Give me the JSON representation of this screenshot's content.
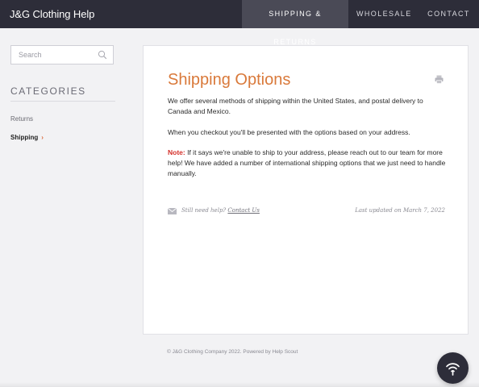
{
  "header": {
    "brand": "J&G Clothing Help",
    "nav": [
      {
        "label": "SHIPPING & RETURNS",
        "active": true
      },
      {
        "label": "WHOLESALE",
        "active": false
      },
      {
        "label": "CONTACT",
        "active": false
      }
    ]
  },
  "sidebar": {
    "search_placeholder": "Search",
    "categories_title": "CATEGORIES",
    "items": [
      {
        "label": "Returns",
        "active": false
      },
      {
        "label": "Shipping",
        "active": true
      }
    ]
  },
  "article": {
    "title": "Shipping Options",
    "paragraph1": "We offer several methods of shipping within the United States, and postal delivery to Canada and Mexico.",
    "paragraph2": "When you checkout you'll be presented with the options based on your address.",
    "note_label": "Note:",
    "note_text": " If it says we're unable to ship to your address, please reach out to our team for more help! We have added a number of international shipping options that we just need to handle manually.",
    "help_prefix": "Still need help? ",
    "contact_link": "Contact Us",
    "last_updated": "Last updated on March 7, 2022"
  },
  "footer": {
    "text": "© J&G Clothing Company 2022. Powered by Help Scout"
  },
  "colors": {
    "accent": "#d9793a",
    "note": "#d4302a",
    "header_bg": "#2d2d39"
  },
  "icons": [
    "search-icon",
    "print-icon",
    "mail-icon",
    "beacon-signal-icon",
    "chevron-right-icon"
  ]
}
